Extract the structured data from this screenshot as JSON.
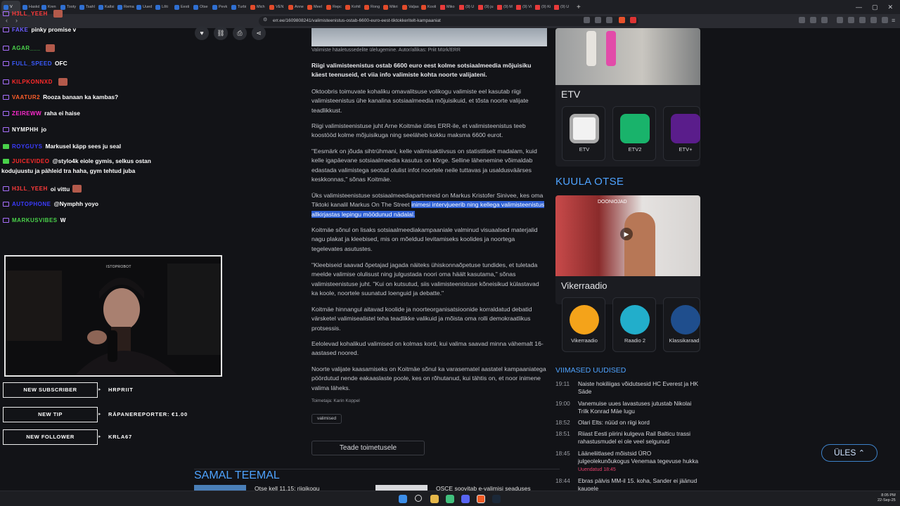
{
  "browser": {
    "tabs": [
      "V",
      "Haskd",
      "Kren",
      "Tooty",
      "Tsahl",
      "Kaltsi",
      "Rema",
      "Uued",
      "Lõti",
      "Eesti",
      "Otse",
      "Pevk",
      "Turbi",
      "Mich",
      "VEN",
      "Anne",
      "Meel",
      "Repc",
      "Kohtl",
      "Rong",
      "Mikri",
      "Valjas",
      "Kooli",
      "Miko",
      "(9) U",
      "(9) ju",
      "(9) M",
      "(9) Vi",
      "(9) Ki",
      "(9) U"
    ],
    "url": "err.ee/1609808241/valimisteenistus-ostab-6600-euro-eest-tiktokkeritelt-kampaaniat"
  },
  "chat": [
    {
      "user": "H3LL_YEEH",
      "msg": "",
      "color": "#ff3b3b"
    },
    {
      "user": "FAKE",
      "msg": "pinky promise v",
      "color": "#6a5cff"
    },
    {
      "user": "AGAR___",
      "msg": "",
      "color": "#49d14a"
    },
    {
      "user": "FULL_SPEED",
      "msg": "OFC",
      "color": "#3b5bff"
    },
    {
      "user": "KILPKONNXD",
      "msg": "",
      "color": "#ff2a2a"
    },
    {
      "user": "VAATUR2",
      "msg": "Rooza banaan ka kambas?",
      "color": "#ff5f2a"
    },
    {
      "user": "ZEIREWW",
      "msg": "raha ei haise",
      "color": "#ff2ad0"
    },
    {
      "user": "NYMPHH",
      "msg": "jo",
      "color": "#ffffff"
    },
    {
      "user": "ROYGUYS",
      "msg": "Markusel käpp sees ju seal",
      "color": "#3b3bff"
    },
    {
      "user": "JUICEVIDEO",
      "msg": "@stylo4k eiole gymis, selkus ostan",
      "color": "#ff2a2a"
    },
    {
      "user": "",
      "msg": "kodujuustu ja pähleid tra haha, gym tehtud juba",
      "color": "#fff"
    },
    {
      "user": "H3LL_YEEH",
      "msg": "oi vittu",
      "color": "#ff3b3b"
    },
    {
      "user": "AUTOPHONE",
      "msg": "@Nymphh yoyo",
      "color": "#3b3bff"
    },
    {
      "user": "MARKUSVIBES",
      "msg": "W",
      "color": "#49d14a"
    }
  ],
  "alerts": [
    {
      "label": "NEW SUBSCRIBER",
      "value": "HRPRIIT"
    },
    {
      "label": "NEW TIP",
      "value": "RÄPANEREPORTER: €1.00"
    },
    {
      "label": "NEW FOLLOWER",
      "value": "KRLA67"
    }
  ],
  "webcam": {
    "tag": "ISTOPROBOT"
  },
  "article": {
    "caption": "Valimiste häaletussedelite ülelugemine. Autor/allikas: Priit Mürk/ERR",
    "lead": "Riigi valimisteenistus ostab 6600 euro eest kolme sotsiaalmeedia mõjuisiku käest teenuseid, et viia info valimiste kohta noorte valijateni.",
    "p1": "Oktoobris toimuvate kohaliku omavalitsuse volikogu valimiste eel kasutab riigi valimisteenistus ühe kanalina sotsiaalmeedia mõjuisikuid, et tõsta noorte valijate teadlikkust.",
    "p2": "Riigi valimisteenistuse juht Arne Koitmäe ütles ERR-ile, et valimisteenistus teeb koostööd kolme mõjuisikuga ning seeläheb kokku maksma 6600 eurot.",
    "p3": "\"Eesmärk on jõuda sihtrühmani, kelle valimisaktiivsus on statistiliselt madalam, kuid kelle igapäevane sotsiaalmeedia kasutus on kõrge. Selline lähenemine võimaldab edastada valimistega seotud olulist infot noortele neile tuttavas ja usaldusväärses keskkonnas,\" sõnas Koitmäe.",
    "p4a": "Üks valimisteenistuse sotsiaalmeediapartnereid on Markus Kristofer Sinivee, kes oma Tiktoki kanalil Markus On The Street",
    "p4b": "inimesi intervjueerib ning kellega valimisteenistus allkirjastas lepingu möödunud nädalal.",
    "p5": "Koitmäe sõnul on lisaks sotsiaalmeediakampaaniale valminud visuaalsed materjalid nagu plakat ja kleebised, mis on mõeldud levitamiseks koolides ja noortega tegelevates asutustes.",
    "p6": "\"Kleebiseid saavad õpetajad jagada näiteks ühiskonnaõpetuse tundides, et tuletada meelde valimise olulisust ning julgustada noori oma häält kasutama,\" sõnas valimisteenistuse juht. \"Kui on kutsutud, siis valimisteenistuse kõneisikud külastavad ka koole, noortele suunatud loenguid ja debatte.\"",
    "p7": "Koitmäe hinnangul aitavad koolide ja noorteorganisatsioonide korraldatud debatid värsketel valimisealistel teha teadlikke valikuid ja mõista oma rolli demokraatlikus protsessis.",
    "p8": "Eelolevad kohalikud valimised on kolmas kord, kui valima saavad minna vähemalt 16-aastased noored.",
    "p9": "Noorte valijate kaasamiseks on Koitmäe sõnul ka varasematel aastatel kampaaniatega pöördutud nende eakaaslaste poole, kes on rõhutanud, kui tähtis on, et noor inimene valima läheks.",
    "editor": "Toimetaja: Karin Koppel",
    "tag": "valimised",
    "report_btn": "Teade toimetusele",
    "related_title": "SAMAL TEEMAL",
    "related1": "Otse kell 11.15: riigikogu",
    "related2": "OSCE soovitab e-valimisi seaduses"
  },
  "sidebar": {
    "etv_title": "ETV",
    "etv_apps": [
      "ETV",
      "ETV2",
      "ETV+"
    ],
    "kuula_title": "KUULA OTSE",
    "radio_banner": "DOONIOJAD",
    "radio_title": "Vikerraadio",
    "radio_apps": [
      "Vikerraadio",
      "Raadio 2",
      "Klassikaraad"
    ],
    "news_title": "VIIMASED UUDISED",
    "news": [
      {
        "time": "19:11",
        "title": "Naiste hokiliigas võidutsesid HC Everest ja HK Säde",
        "upd": ""
      },
      {
        "time": "19:00",
        "title": "Vanemuise uues lavastuses jutustab Nikolai Trilk Konrad Mäe lugu",
        "upd": ""
      },
      {
        "time": "18:52",
        "title": "Olari Elts: nüüd on riigi kord",
        "upd": ""
      },
      {
        "time": "18:51",
        "title": "Riiast Eesti piirini kulgeva Rail Balticu trassi rahastusmudel ei ole veel selgunud",
        "upd": ""
      },
      {
        "time": "18:45",
        "title": "Lääneliitlased mõistsid ÜRO julgeolekunõukogus Venemaa tegevuse hukka",
        "upd": "Uuendatud 18:45"
      },
      {
        "time": "18:44",
        "title": "Ebras pälvis MM-il 15. koha, Sander ei jäänud kaugele",
        "upd": ""
      }
    ],
    "top_btn": "ÜLES"
  },
  "system": {
    "time": "8:05 PM",
    "date": "22-Sep-25"
  }
}
